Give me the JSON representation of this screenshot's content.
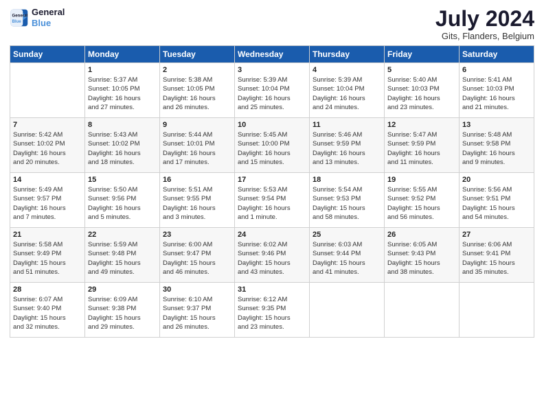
{
  "header": {
    "logo_line1": "General",
    "logo_line2": "Blue",
    "title": "July 2024",
    "location": "Gits, Flanders, Belgium"
  },
  "columns": [
    "Sunday",
    "Monday",
    "Tuesday",
    "Wednesday",
    "Thursday",
    "Friday",
    "Saturday"
  ],
  "rows": [
    [
      {
        "date": "",
        "content": ""
      },
      {
        "date": "1",
        "content": "Sunrise: 5:37 AM\nSunset: 10:05 PM\nDaylight: 16 hours\nand 27 minutes."
      },
      {
        "date": "2",
        "content": "Sunrise: 5:38 AM\nSunset: 10:05 PM\nDaylight: 16 hours\nand 26 minutes."
      },
      {
        "date": "3",
        "content": "Sunrise: 5:39 AM\nSunset: 10:04 PM\nDaylight: 16 hours\nand 25 minutes."
      },
      {
        "date": "4",
        "content": "Sunrise: 5:39 AM\nSunset: 10:04 PM\nDaylight: 16 hours\nand 24 minutes."
      },
      {
        "date": "5",
        "content": "Sunrise: 5:40 AM\nSunset: 10:03 PM\nDaylight: 16 hours\nand 23 minutes."
      },
      {
        "date": "6",
        "content": "Sunrise: 5:41 AM\nSunset: 10:03 PM\nDaylight: 16 hours\nand 21 minutes."
      }
    ],
    [
      {
        "date": "7",
        "content": "Sunrise: 5:42 AM\nSunset: 10:02 PM\nDaylight: 16 hours\nand 20 minutes."
      },
      {
        "date": "8",
        "content": "Sunrise: 5:43 AM\nSunset: 10:02 PM\nDaylight: 16 hours\nand 18 minutes."
      },
      {
        "date": "9",
        "content": "Sunrise: 5:44 AM\nSunset: 10:01 PM\nDaylight: 16 hours\nand 17 minutes."
      },
      {
        "date": "10",
        "content": "Sunrise: 5:45 AM\nSunset: 10:00 PM\nDaylight: 16 hours\nand 15 minutes."
      },
      {
        "date": "11",
        "content": "Sunrise: 5:46 AM\nSunset: 9:59 PM\nDaylight: 16 hours\nand 13 minutes."
      },
      {
        "date": "12",
        "content": "Sunrise: 5:47 AM\nSunset: 9:59 PM\nDaylight: 16 hours\nand 11 minutes."
      },
      {
        "date": "13",
        "content": "Sunrise: 5:48 AM\nSunset: 9:58 PM\nDaylight: 16 hours\nand 9 minutes."
      }
    ],
    [
      {
        "date": "14",
        "content": "Sunrise: 5:49 AM\nSunset: 9:57 PM\nDaylight: 16 hours\nand 7 minutes."
      },
      {
        "date": "15",
        "content": "Sunrise: 5:50 AM\nSunset: 9:56 PM\nDaylight: 16 hours\nand 5 minutes."
      },
      {
        "date": "16",
        "content": "Sunrise: 5:51 AM\nSunset: 9:55 PM\nDaylight: 16 hours\nand 3 minutes."
      },
      {
        "date": "17",
        "content": "Sunrise: 5:53 AM\nSunset: 9:54 PM\nDaylight: 16 hours\nand 1 minute."
      },
      {
        "date": "18",
        "content": "Sunrise: 5:54 AM\nSunset: 9:53 PM\nDaylight: 15 hours\nand 58 minutes."
      },
      {
        "date": "19",
        "content": "Sunrise: 5:55 AM\nSunset: 9:52 PM\nDaylight: 15 hours\nand 56 minutes."
      },
      {
        "date": "20",
        "content": "Sunrise: 5:56 AM\nSunset: 9:51 PM\nDaylight: 15 hours\nand 54 minutes."
      }
    ],
    [
      {
        "date": "21",
        "content": "Sunrise: 5:58 AM\nSunset: 9:49 PM\nDaylight: 15 hours\nand 51 minutes."
      },
      {
        "date": "22",
        "content": "Sunrise: 5:59 AM\nSunset: 9:48 PM\nDaylight: 15 hours\nand 49 minutes."
      },
      {
        "date": "23",
        "content": "Sunrise: 6:00 AM\nSunset: 9:47 PM\nDaylight: 15 hours\nand 46 minutes."
      },
      {
        "date": "24",
        "content": "Sunrise: 6:02 AM\nSunset: 9:46 PM\nDaylight: 15 hours\nand 43 minutes."
      },
      {
        "date": "25",
        "content": "Sunrise: 6:03 AM\nSunset: 9:44 PM\nDaylight: 15 hours\nand 41 minutes."
      },
      {
        "date": "26",
        "content": "Sunrise: 6:05 AM\nSunset: 9:43 PM\nDaylight: 15 hours\nand 38 minutes."
      },
      {
        "date": "27",
        "content": "Sunrise: 6:06 AM\nSunset: 9:41 PM\nDaylight: 15 hours\nand 35 minutes."
      }
    ],
    [
      {
        "date": "28",
        "content": "Sunrise: 6:07 AM\nSunset: 9:40 PM\nDaylight: 15 hours\nand 32 minutes."
      },
      {
        "date": "29",
        "content": "Sunrise: 6:09 AM\nSunset: 9:38 PM\nDaylight: 15 hours\nand 29 minutes."
      },
      {
        "date": "30",
        "content": "Sunrise: 6:10 AM\nSunset: 9:37 PM\nDaylight: 15 hours\nand 26 minutes."
      },
      {
        "date": "31",
        "content": "Sunrise: 6:12 AM\nSunset: 9:35 PM\nDaylight: 15 hours\nand 23 minutes."
      },
      {
        "date": "",
        "content": ""
      },
      {
        "date": "",
        "content": ""
      },
      {
        "date": "",
        "content": ""
      }
    ]
  ]
}
